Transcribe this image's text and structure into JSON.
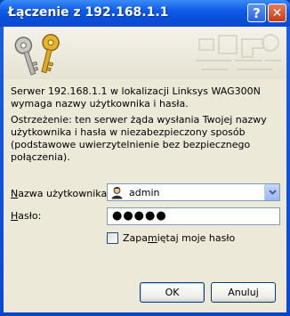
{
  "window": {
    "title": "Łączenie z 192.168.1.1",
    "help_glyph": "?",
    "close_glyph": "✕"
  },
  "message": {
    "info": "Serwer 192.168.1.1 w lokalizacji Linksys WAG300N wymaga nazwy użytkownika i hasła.",
    "warning": "Ostrzeżenie: ten serwer żąda wysłania Twojej nazwy użytkownika i hasła w niezabezpieczony sposób (podstawowe uwierzytelnienie bez bezpiecznego połączenia)."
  },
  "form": {
    "username_label_accel": "N",
    "username_label_rest": "azwa użytkownika:",
    "username_value": "admin",
    "password_label_accel": "H",
    "password_label_rest": "asło:",
    "password_value": "●●●●●",
    "remember_label_prefix": "Zapa",
    "remember_label_accel": "m",
    "remember_label_rest": "iętaj moje hasło",
    "remember_checked": false
  },
  "buttons": {
    "ok_label": "OK",
    "cancel_label": "Anuluj"
  },
  "colors": {
    "titlebar": "#0a4fd9",
    "dialog_bg": "#ece9d8",
    "field_border": "#7f9db9"
  },
  "icons": [
    "keys-icon",
    "user-icon",
    "chevron-down-icon",
    "help-icon",
    "close-icon"
  ]
}
